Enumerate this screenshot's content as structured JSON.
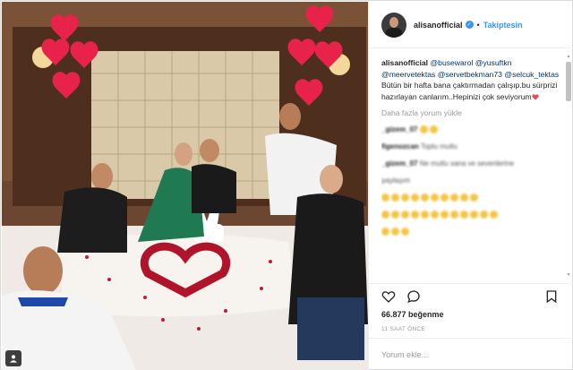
{
  "post": {
    "username": "alisanofficial",
    "separator": "•",
    "follow_label": "Takiptesin",
    "caption": {
      "username": "alisanofficial",
      "mentions": [
        "@busewarol",
        "@yusuftkn",
        "@meervetektas",
        "@servetbekman73",
        "@selcuk_tektas"
      ],
      "text": "Bütün bir hafta bana çaktırmadan çalışıp.bu sürprizi hazırlayan canlarım..Hepinizi çok seviyorum"
    },
    "load_more_label": "Daha fazla yorum yükle",
    "blurred_comments": [
      {
        "user": "_gizem_07",
        "text": ""
      },
      {
        "user": "figenozcan",
        "text": "Toplu mutlu"
      },
      {
        "user": "_gizem_07",
        "text": "Ne mutlu sana ve sevenlerine"
      },
      {
        "user": "",
        "text": "paylaşım"
      }
    ],
    "likes": "66.877 beğenme",
    "time": "11 SAAT ÖNCE",
    "comment_placeholder": "Yorum ekle..."
  },
  "icons": {
    "header_verified": "verified-badge-icon",
    "like": "heart-icon",
    "comment": "comment-bubble-icon",
    "save": "bookmark-icon",
    "photo_tag": "user-tag-icon"
  },
  "colors": {
    "link": "#3897f0",
    "mention": "#003569",
    "muted": "#999999",
    "heart": "#ed4956"
  }
}
